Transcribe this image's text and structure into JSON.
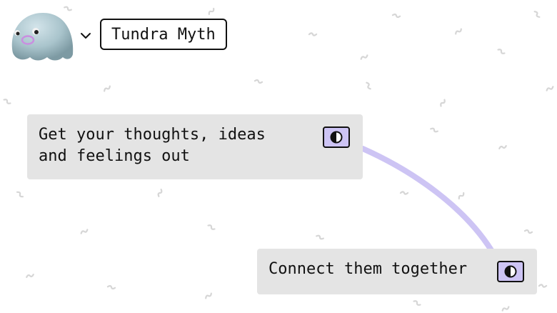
{
  "header": {
    "project_name": "Tundra Myth",
    "avatar_icon": "blob-creature-avatar",
    "menu_icon": "chevron-down-icon"
  },
  "cards": [
    {
      "text": "Get your thoughts, ideas and feelings out",
      "toggle_icon": "contrast-icon"
    },
    {
      "text": "Connect them together",
      "toggle_icon": "contrast-icon"
    }
  ],
  "colors": {
    "background": "#ffffff",
    "card": "#e4e4e4",
    "connector": "#cdc4f4",
    "toggle": "#cdc4f4",
    "squiggle": "#d6d6d6",
    "avatar": "#a9c4cc"
  }
}
